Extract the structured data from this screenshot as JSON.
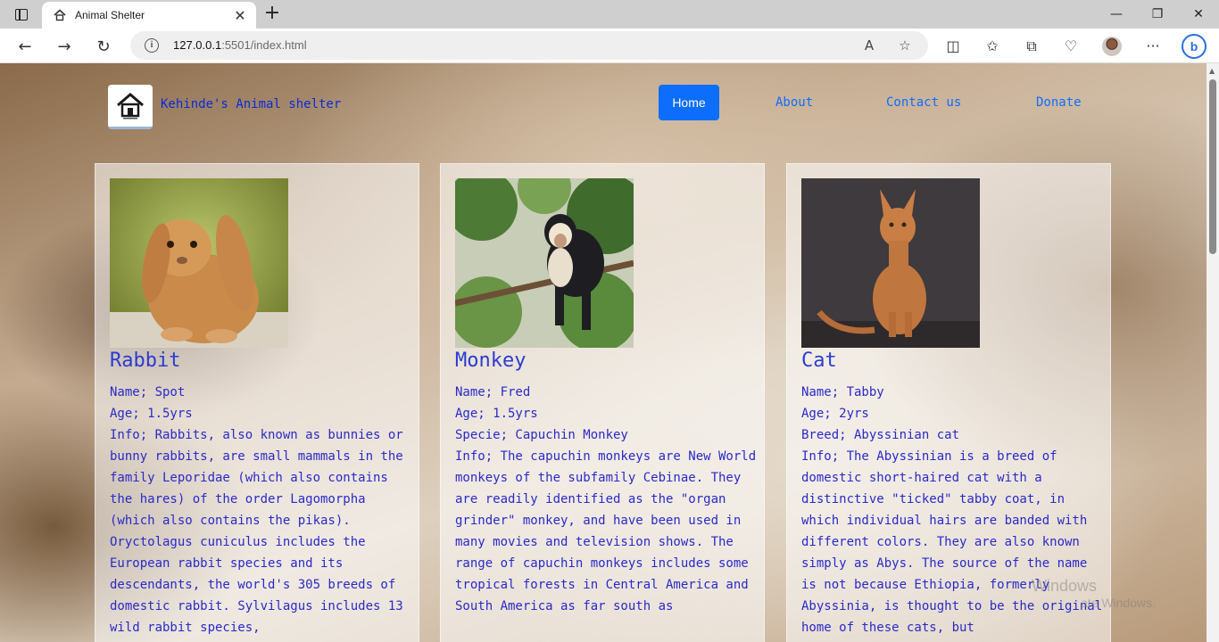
{
  "browser": {
    "tab_title": "Animal Shelter",
    "url_host": "127.0.0.1",
    "url_rest": ":5501/index.html"
  },
  "site": {
    "brand": "Kehinde's Animal shelter",
    "nav": [
      "Home",
      "About",
      "Contact us",
      "Donate"
    ],
    "active_nav": "Home"
  },
  "cards": [
    {
      "title": "Rabbit",
      "lines": [
        "Name; Spot",
        "Age; 1.5yrs",
        "Info; Rabbits, also known as bunnies or bunny rabbits, are small mammals in the family Leporidae (which also contains the hares) of the order Lagomorpha (which also contains the pikas). Oryctolagus cuniculus includes the European rabbit species and its descendants, the world's 305 breeds of domestic rabbit. Sylvilagus includes 13 wild rabbit species,"
      ]
    },
    {
      "title": "Monkey",
      "lines": [
        "Name; Fred",
        "Age; 1.5yrs",
        "Specie; Capuchin Monkey",
        "Info; The capuchin monkeys are New World monkeys of the subfamily Cebinae. They are readily identified as the \"organ grinder\" monkey, and have been used in many movies and television shows. The range of capuchin monkeys includes some tropical forests in Central America and South America as far south as"
      ]
    },
    {
      "title": "Cat",
      "lines": [
        "Name; Tabby",
        "Age; 2yrs",
        "Breed; Abyssinian cat",
        "Info; The Abyssinian is a breed of domestic short-haired cat with a distinctive \"ticked\" tabby coat, in which individual hairs are banded with different colors. They are also known simply as Abys. The source of the name is not because Ethiopia, formerly Abyssinia, is thought to be the original home of these cats, but"
      ]
    }
  ],
  "watermark": {
    "line1": "Windows",
    "line2": "ate Windows."
  },
  "colors": {
    "accent": "#0d6efd",
    "text": "#2a2ac8"
  }
}
